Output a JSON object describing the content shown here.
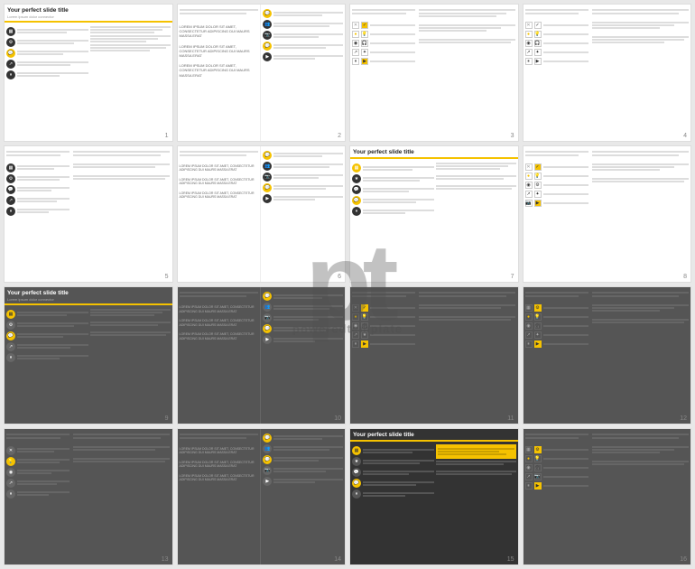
{
  "watermark": {
    "letters": "pt",
    "text": "poweredtemplate"
  },
  "slides": [
    {
      "number": "1",
      "title": "Your perfect slide title",
      "subtitle": "Lorem ipsum dolor connector"
    },
    {
      "number": "2",
      "title": "",
      "subtitle": ""
    },
    {
      "number": "3",
      "title": "",
      "subtitle": ""
    },
    {
      "number": "4",
      "title": "",
      "subtitle": ""
    },
    {
      "number": "5",
      "title": "",
      "subtitle": ""
    },
    {
      "number": "6",
      "title": "",
      "subtitle": ""
    },
    {
      "number": "7",
      "title": "Your perfect slide title",
      "subtitle": ""
    },
    {
      "number": "8",
      "title": "",
      "subtitle": ""
    },
    {
      "number": "9",
      "title": "Your perfect slide title",
      "subtitle": "Lorem ipsum dolor connector"
    },
    {
      "number": "10",
      "title": "",
      "subtitle": ""
    },
    {
      "number": "11",
      "title": "",
      "subtitle": ""
    },
    {
      "number": "12",
      "title": "",
      "subtitle": ""
    },
    {
      "number": "13",
      "title": "",
      "subtitle": ""
    },
    {
      "number": "14",
      "title": "",
      "subtitle": ""
    },
    {
      "number": "15",
      "title": "Your perfect slide title",
      "subtitle": ""
    },
    {
      "number": "16",
      "title": "",
      "subtitle": ""
    }
  ],
  "lorem": "LOREM IPSUM DOLOR SIT AMET, CONSECTETUR ADIPISCING DUI MAURS MASSA ERAT",
  "lorem_short": "Lorem ipsum dolor sit amet consectetur"
}
